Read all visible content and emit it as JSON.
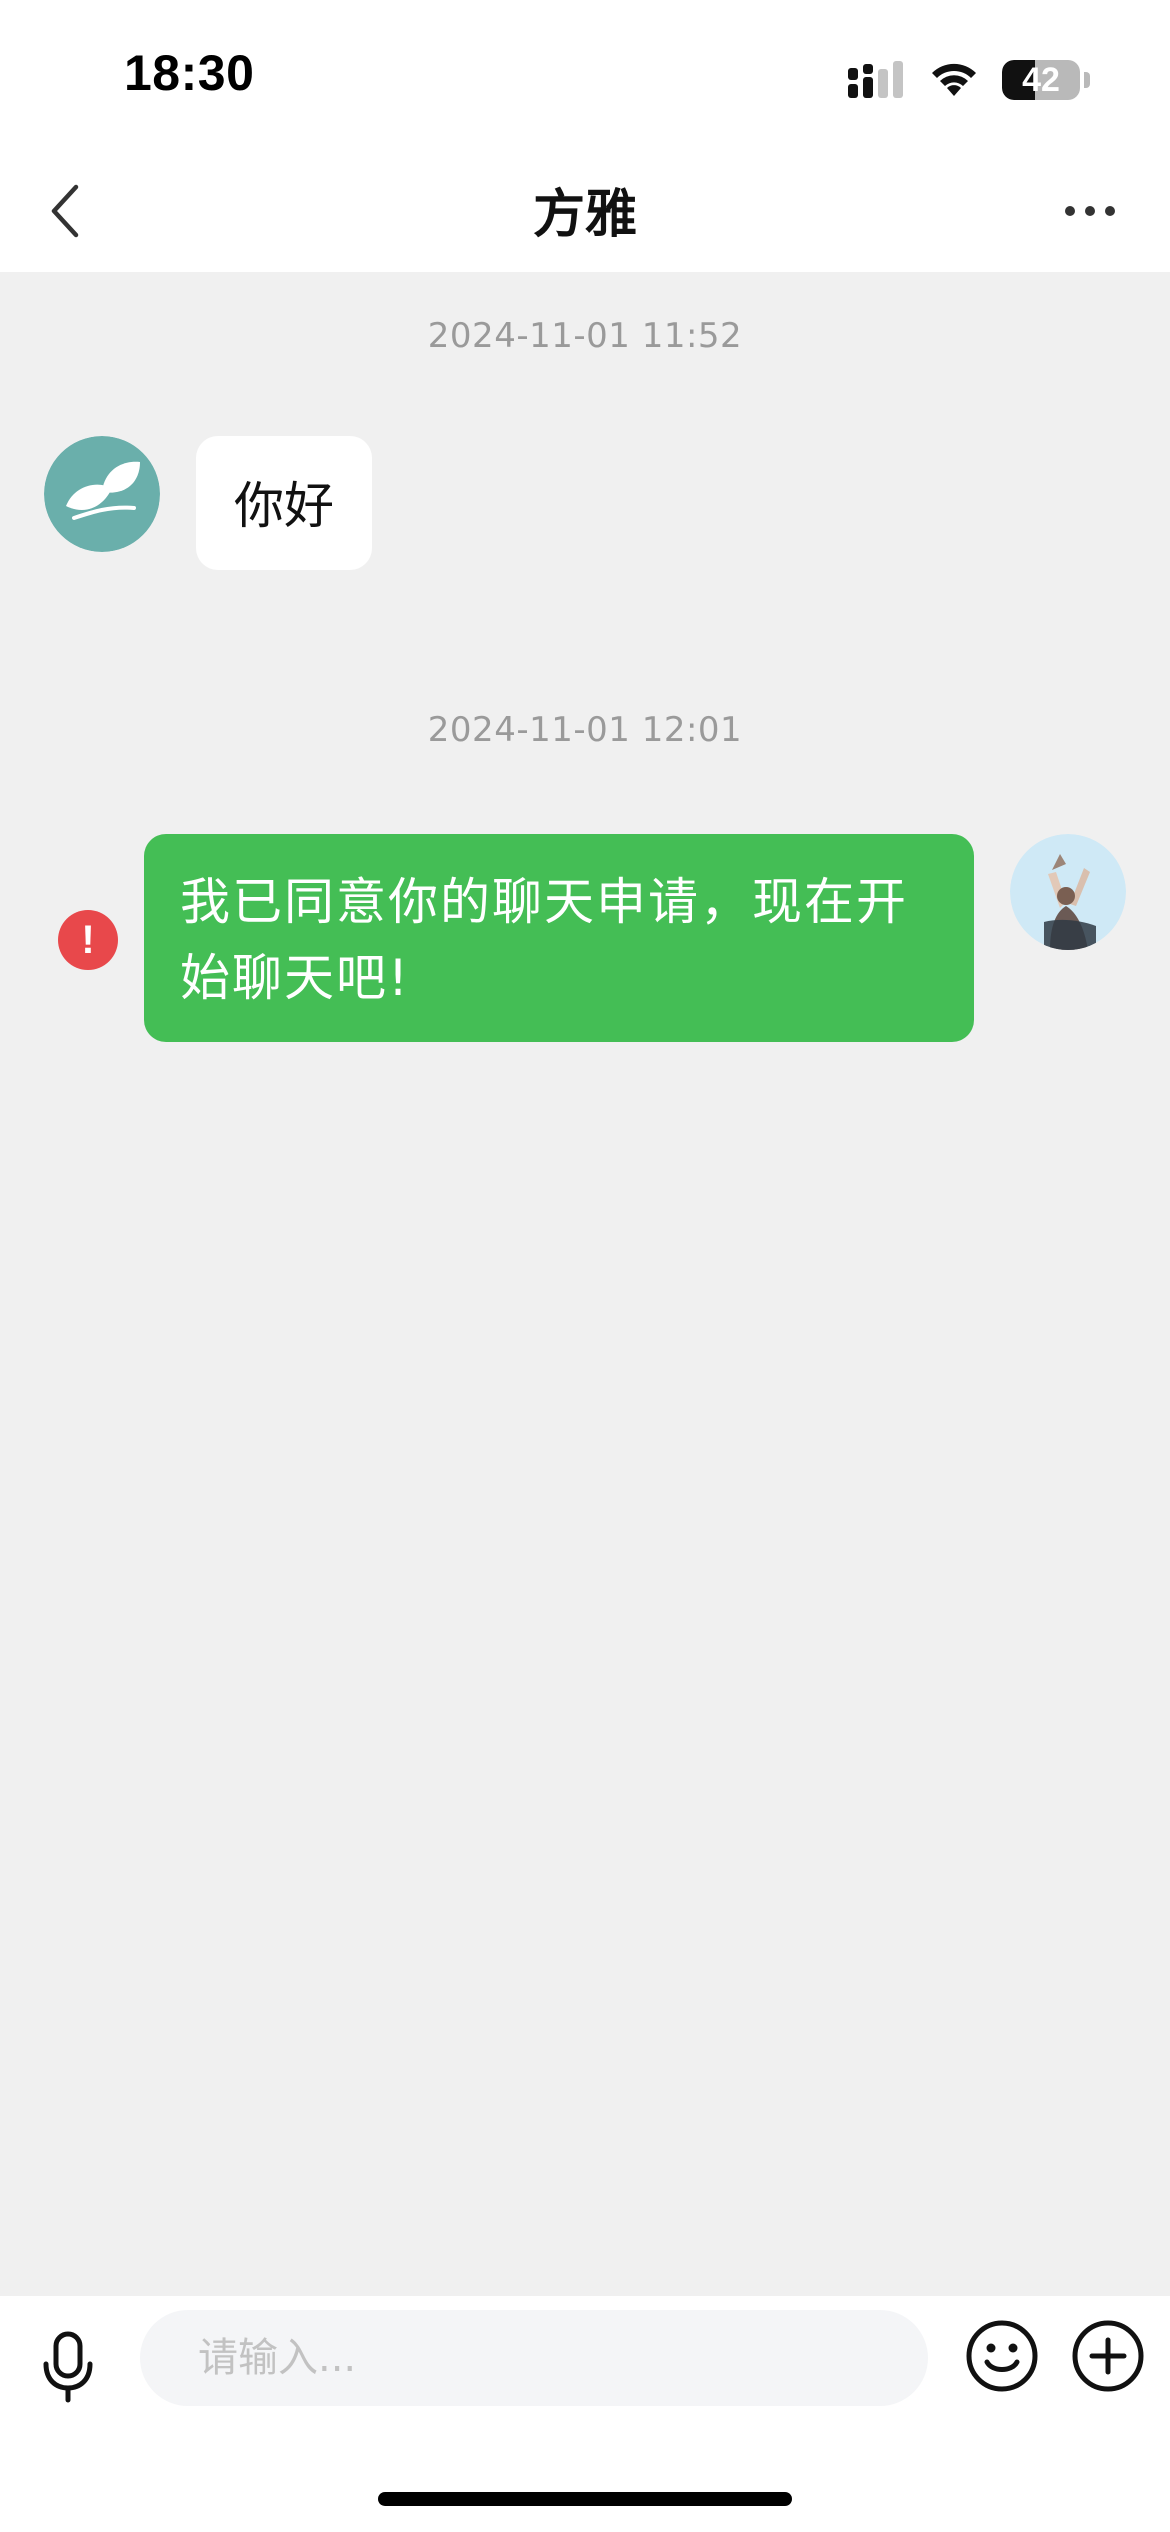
{
  "status_bar": {
    "time": "18:30",
    "battery_level": "42",
    "battery_fraction": 0.42
  },
  "nav": {
    "title": "方雅",
    "back_icon": "chevron-left-icon",
    "more_icon": "more-horizontal-icon"
  },
  "messages": [
    {
      "timestamp": "2024-11-01 11:52",
      "direction": "incoming",
      "text": "你好",
      "avatar_icon": "leaf-logo-avatar"
    },
    {
      "timestamp": "2024-11-01 12:01",
      "direction": "outgoing",
      "text": "我已同意你的聊天申请，现在开始聊天吧!",
      "status": "failed",
      "status_icon": "exclamation-icon",
      "avatar_icon": "user-photo-avatar"
    }
  ],
  "composer": {
    "placeholder": "请输入...",
    "mic_icon": "microphone-icon",
    "emoji_icon": "smiley-icon",
    "plus_icon": "plus-circle-icon"
  },
  "colors": {
    "outgoing_bubble": "#44be55",
    "incoming_bubble": "#ffffff",
    "chat_background": "#f0f0f0",
    "error": "#e8484b"
  }
}
